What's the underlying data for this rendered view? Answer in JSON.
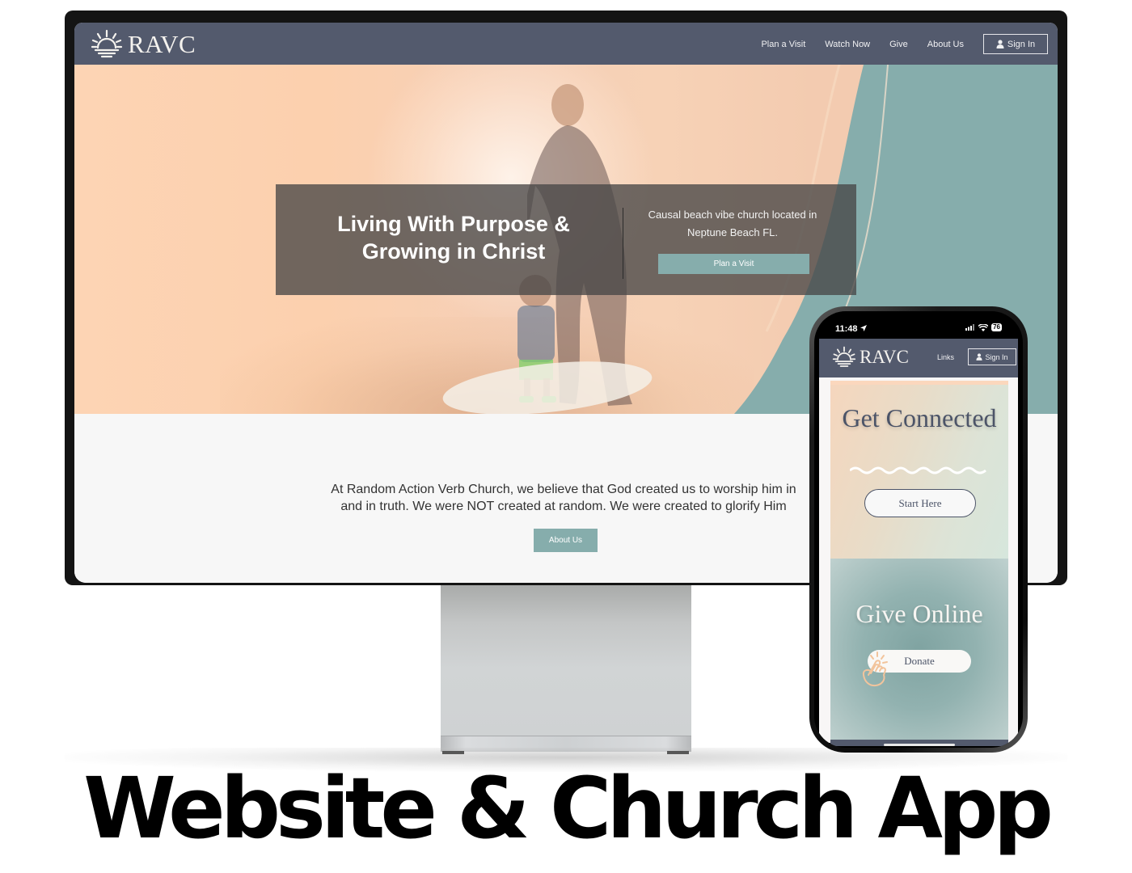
{
  "caption": "Website & Church App",
  "colors": {
    "header_bg": "#535a6d",
    "accent_teal": "#86adac",
    "hero_peach": "#fcd0ae",
    "overlay": "#484646",
    "connect_text": "#4c5468",
    "hand_icon": "#f2c49c"
  },
  "website": {
    "logo": {
      "icon": "sunrise-icon",
      "text": "RAVC"
    },
    "nav": [
      {
        "label": "Plan a Visit"
      },
      {
        "label": "Watch Now"
      },
      {
        "label": "Give"
      },
      {
        "label": "About Us"
      }
    ],
    "sign_in": {
      "icon": "user-icon",
      "label": "Sign In"
    },
    "hero": {
      "title": "Living With Purpose & Growing in Christ",
      "subtitle": "Causal beach vibe church located in Neptune Beach FL.",
      "button": "Plan a Visit"
    },
    "about": {
      "text": "At Random Action Verb Church, we believe that God created us to worship him in\nand in truth. We were NOT created at random. We were created to glorify Him",
      "button": "About Us"
    }
  },
  "app": {
    "status_bar": {
      "time": "11:48",
      "location_icon": "location-arrow-icon",
      "signal_icon": "signal-icon",
      "wifi_icon": "wifi-icon",
      "battery": "76"
    },
    "logo": {
      "icon": "sunrise-icon",
      "text": "RAVC"
    },
    "links_label": "Links",
    "sign_in": {
      "icon": "user-icon",
      "label": "Sign In"
    },
    "connect": {
      "title": "Get Connected",
      "button": "Start Here"
    },
    "give": {
      "title": "Give Online",
      "button": "Donate",
      "icon": "tap-hand-icon"
    }
  }
}
